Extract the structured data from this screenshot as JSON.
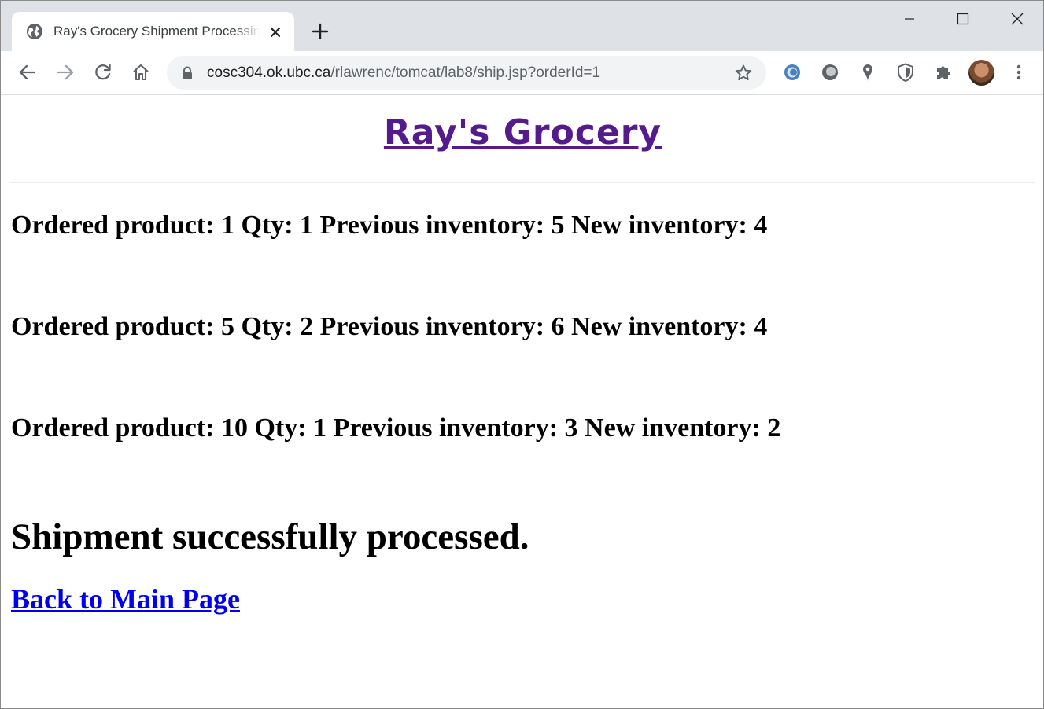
{
  "browser": {
    "tab": {
      "title": "Ray's Grocery Shipment Processing",
      "favicon": "globe-icon"
    },
    "address_bar": {
      "host": "cosc304.ok.ubc.ca",
      "path": "/rlawrenc/tomcat/lab8/ship.jsp?orderId=1"
    },
    "nav_icons": [
      "back-arrow-icon",
      "forward-arrow-icon",
      "reload-icon",
      "home-icon"
    ],
    "extension_icons": [
      "ring-extension-icon",
      "circle-extension-icon",
      "map-pin-extension-icon",
      "shield-extension-icon",
      "puzzle-extensions-icon"
    ],
    "colors": {
      "tabstrip": "#dee1e6",
      "omnibox": "#f1f3f4"
    }
  },
  "page": {
    "site_title": "Ray's Grocery",
    "lines": [
      "Ordered product: 1 Qty: 1 Previous inventory: 5 New inventory: 4",
      "Ordered product: 5 Qty: 2 Previous inventory: 6 New inventory: 4",
      "Ordered product: 10 Qty: 1 Previous inventory: 3 New inventory: 2"
    ],
    "status_message": "Shipment successfully processed.",
    "back_link": "Back to Main Page",
    "colors": {
      "visited_link": "#551a8b",
      "link": "#0000ee"
    }
  }
}
